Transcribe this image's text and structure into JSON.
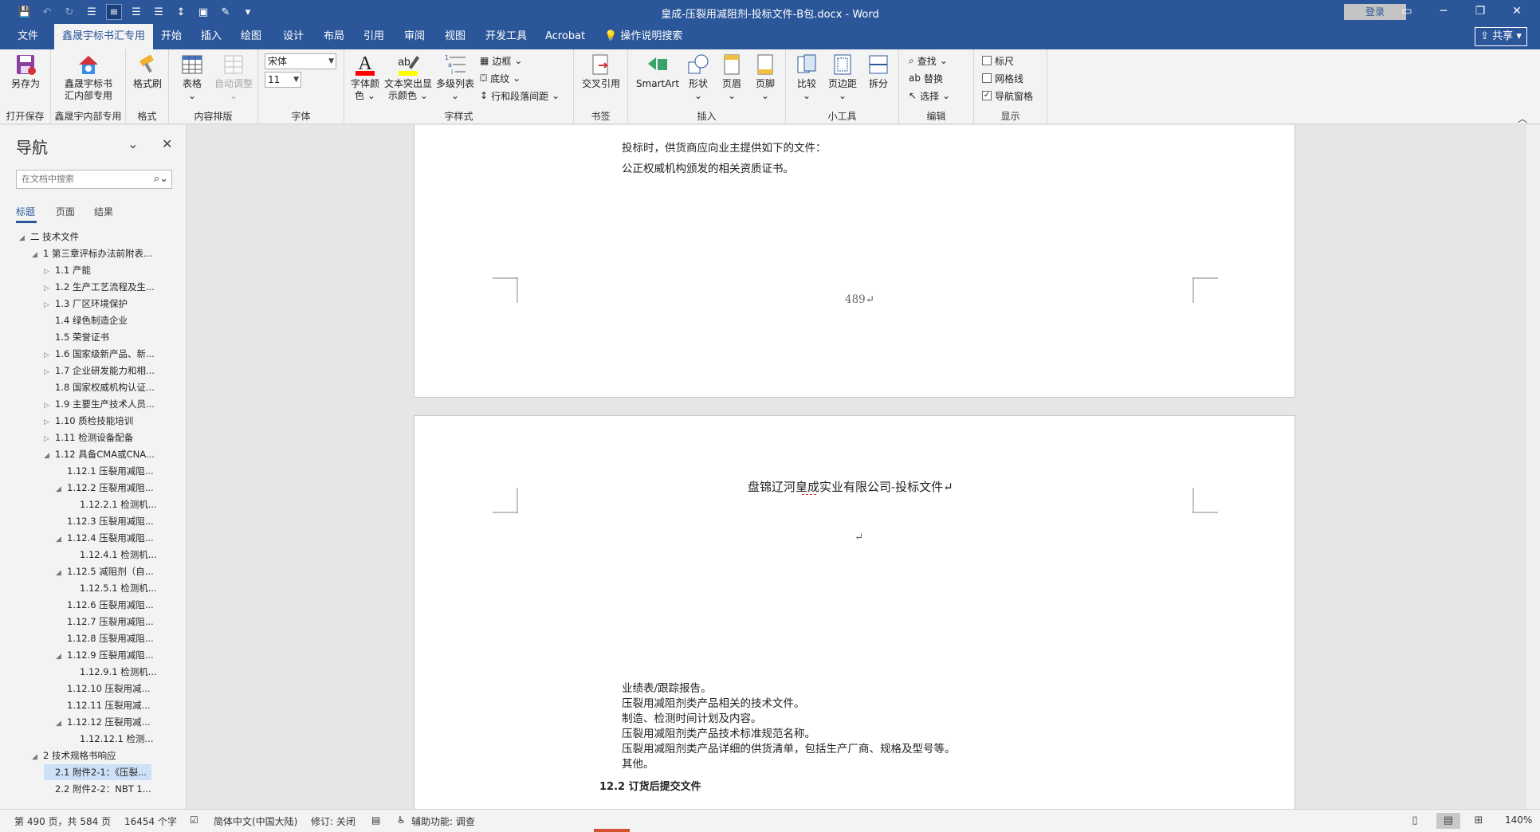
{
  "window": {
    "title": "皇成-压裂用减阻剂-投标文件-B包.docx  -  Word",
    "login_label": "登录",
    "share_label": "共享"
  },
  "tabs": [
    "文件",
    "鑫晟宇标书汇专用",
    "开始",
    "插入",
    "绘图",
    "设计",
    "布局",
    "引用",
    "审阅",
    "视图",
    "开发工具",
    "Acrobat",
    "操作说明搜索"
  ],
  "ribbon": {
    "save_as": "另存为",
    "group_open_save": "打开保存",
    "xsy_label_1": "鑫晟宇标书",
    "xsy_label_2": "汇内部专用",
    "group_xsy": "鑫晟宇内部专用",
    "format_painter": "格式刷",
    "group_format": "格式",
    "table": "表格",
    "auto_adjust": "自动调整",
    "group_layout": "内容排版",
    "font_name": "宋体",
    "font_size": "11",
    "group_font": "字体",
    "font_color_1": "字体颜",
    "font_color_2": "色",
    "highlight_1": "文本突出显",
    "highlight_2": "示颜色",
    "multilevel": "多级列表",
    "border": "边框",
    "shading": "底纹",
    "line_spacing": "行和段落间距",
    "group_style": "字样式",
    "cross_ref": "交叉引用",
    "group_bookmark": "书签",
    "smartart": "SmartArt",
    "shapes": "形状",
    "header": "页眉",
    "footer": "页脚",
    "group_insert": "插入",
    "compare": "比较",
    "margins": "页边距",
    "split": "拆分",
    "group_tools": "小工具",
    "find": "查找",
    "replace": "替换",
    "select": "选择",
    "group_edit": "编辑",
    "ruler": "标尺",
    "gridlines": "网格线",
    "nav_pane": "导航窗格",
    "group_show": "显示"
  },
  "nav": {
    "title": "导航",
    "search_placeholder": "在文档中搜索",
    "tabs": [
      "标题",
      "页面",
      "结果"
    ],
    "items": [
      {
        "text": "二 技术文件",
        "level": 0,
        "tw": "◢"
      },
      {
        "text": "1 第三章评标办法前附表...",
        "level": 1,
        "tw": "◢"
      },
      {
        "text": "1.1 产能",
        "level": 2,
        "tw": "▷"
      },
      {
        "text": "1.2 生产工艺流程及生...",
        "level": 2,
        "tw": "▷"
      },
      {
        "text": "1.3 厂区环境保护",
        "level": 2,
        "tw": "▷"
      },
      {
        "text": "1.4 绿色制造企业",
        "level": 2,
        "tw": ""
      },
      {
        "text": "1.5 荣誉证书",
        "level": 2,
        "tw": ""
      },
      {
        "text": "1.6 国家级新产品、新...",
        "level": 2,
        "tw": "▷"
      },
      {
        "text": "1.7 企业研发能力和相...",
        "level": 2,
        "tw": "▷"
      },
      {
        "text": "1.8 国家权威机构认证...",
        "level": 2,
        "tw": ""
      },
      {
        "text": "1.9 主要生产技术人员...",
        "level": 2,
        "tw": "▷"
      },
      {
        "text": "1.10 质检技能培训",
        "level": 2,
        "tw": "▷"
      },
      {
        "text": "1.11 检测设备配备",
        "level": 2,
        "tw": "▷"
      },
      {
        "text": "1.12 具备CMA或CNA...",
        "level": 2,
        "tw": "◢"
      },
      {
        "text": "1.12.1 压裂用减阻...",
        "level": 3,
        "tw": ""
      },
      {
        "text": "1.12.2 压裂用减阻...",
        "level": 3,
        "tw": "◢"
      },
      {
        "text": "1.12.2.1 检测机...",
        "level": 4,
        "tw": ""
      },
      {
        "text": "1.12.3 压裂用减阻...",
        "level": 3,
        "tw": ""
      },
      {
        "text": "1.12.4 压裂用减阻...",
        "level": 3,
        "tw": "◢"
      },
      {
        "text": "1.12.4.1 检测机...",
        "level": 4,
        "tw": ""
      },
      {
        "text": "1.12.5 减阻剂（自...",
        "level": 3,
        "tw": "◢"
      },
      {
        "text": "1.12.5.1 检测机...",
        "level": 4,
        "tw": ""
      },
      {
        "text": "1.12.6 压裂用减阻...",
        "level": 3,
        "tw": ""
      },
      {
        "text": "1.12.7 压裂用减阻...",
        "level": 3,
        "tw": ""
      },
      {
        "text": "1.12.8 压裂用减阻...",
        "level": 3,
        "tw": ""
      },
      {
        "text": "1.12.9 压裂用减阻...",
        "level": 3,
        "tw": "◢"
      },
      {
        "text": "1.12.9.1 检测机...",
        "level": 4,
        "tw": ""
      },
      {
        "text": "1.12.10 压裂用减...",
        "level": 3,
        "tw": ""
      },
      {
        "text": "1.12.11 压裂用减...",
        "level": 3,
        "tw": ""
      },
      {
        "text": "1.12.12 压裂用减...",
        "level": 3,
        "tw": "◢"
      },
      {
        "text": "1.12.12.1 检测...",
        "level": 4,
        "tw": ""
      },
      {
        "text": "2 技术规格书响应",
        "level": 1,
        "tw": "◢"
      },
      {
        "text": "2.1 附件2-1：《压裂...",
        "level": 2,
        "tw": "",
        "selected": true
      },
      {
        "text": "2.2 附件2-2：NBT 1...",
        "level": 2,
        "tw": ""
      }
    ]
  },
  "document": {
    "page1_lines": [
      "投标时，供货商应向业主提供如下的文件：",
      "公正权威机构颁发的相关资质证书。"
    ],
    "page_number": "489↵",
    "header_text": "盘锦辽河皇成实业有限公司-投标文件↵",
    "empty_mark": "↵",
    "page2_lines": [
      "业绩表/跟踪报告。",
      "压裂用减阻剂类产品相关的技术文件。",
      "制造、检测时间计划及内容。",
      "压裂用减阻剂类产品技术标准规范名称。",
      "压裂用减阻剂类产品详细的供货清单，包括生产厂商、规格及型号等。",
      "其他。"
    ],
    "section_heading": "12.2 订货后提交文件"
  },
  "status": {
    "page": "第 490 页，共 584 页",
    "words": "16454 个字",
    "language": "简体中文(中国大陆)",
    "track_changes": "修订: 关闭",
    "accessibility": "辅助功能: 调查",
    "zoom": "140%"
  },
  "colors": {
    "brand": "#2b579a",
    "font_color_bar": "#ff0000",
    "highlight_bar": "#ffff00",
    "selection": "#cce0f7"
  }
}
